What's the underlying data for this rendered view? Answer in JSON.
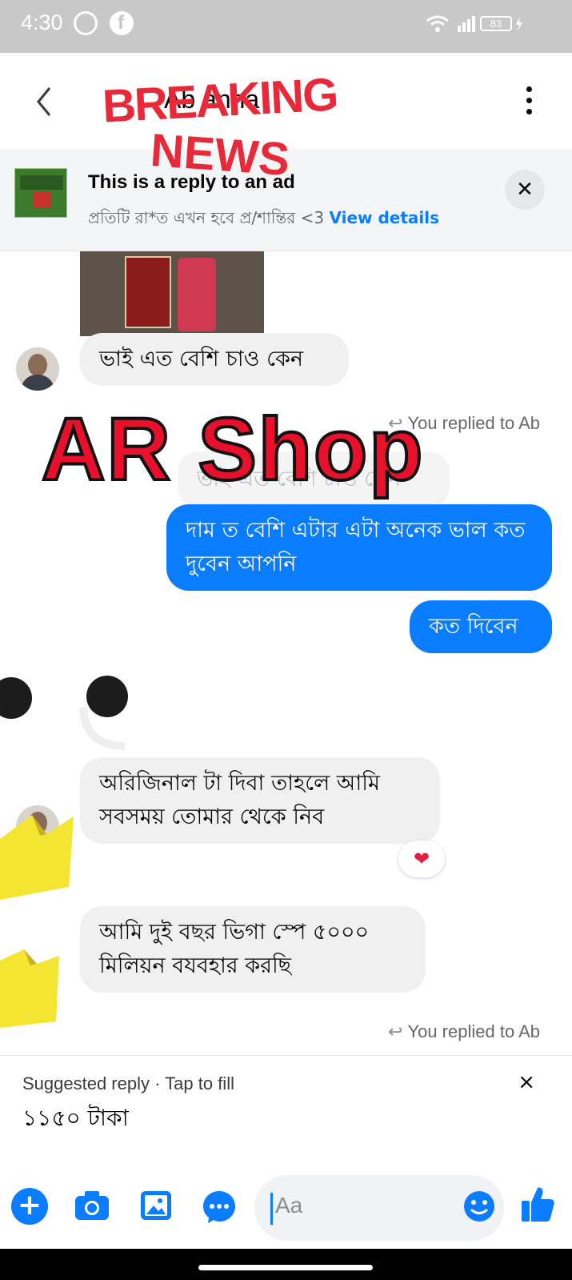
{
  "status_bar": {
    "time": "4:30",
    "battery": "83",
    "icons": [
      "messenger-icon",
      "facebook-icon",
      "wifi-icon",
      "signal-icon",
      "battery-icon",
      "charging-icon"
    ]
  },
  "header": {
    "contact_name": "Ab   anna"
  },
  "ad_banner": {
    "title": "This is a reply to an ad",
    "subtitle": "প্রতিটি রা*ত এখন হবে প্র/শান্তির <3",
    "link": "View details"
  },
  "messages": [
    {
      "side": "in",
      "text": "ভাই এত বেশি চাও কেন"
    },
    {
      "side": "meta",
      "text": "You replied to Ab"
    },
    {
      "side": "quote",
      "text": "ভাই এত বেশি চাও কেন"
    },
    {
      "side": "out",
      "text": "দাম ত বেশি এটার এটা অনেক ভাল কত দুবেন আপনি"
    },
    {
      "side": "out",
      "text": "কত দিবেন"
    },
    {
      "side": "in",
      "text": "অরিজিনাল টা দিবা তাহলে আমি সবসময় তোমার থেকে নিব",
      "reaction": "❤"
    },
    {
      "side": "in",
      "text": "আমি দুই বছর ভিগা স্পে ৫০০০ মিলিয়ন বযবহার করছি"
    },
    {
      "side": "meta",
      "text": "You replied to Ab"
    }
  ],
  "overlays": {
    "breaking": "BREAKING",
    "news": "NEWS",
    "shop": "AR Shop"
  },
  "suggestion": {
    "header": "Suggested reply · Tap to fill",
    "text": "১১৫০ টাকা",
    "close": "×"
  },
  "composer": {
    "placeholder": "Aa"
  },
  "colors": {
    "accent": "#0a7cff",
    "incoming_bubble": "#f0f0f0",
    "overlay_red": "#e8102a"
  }
}
